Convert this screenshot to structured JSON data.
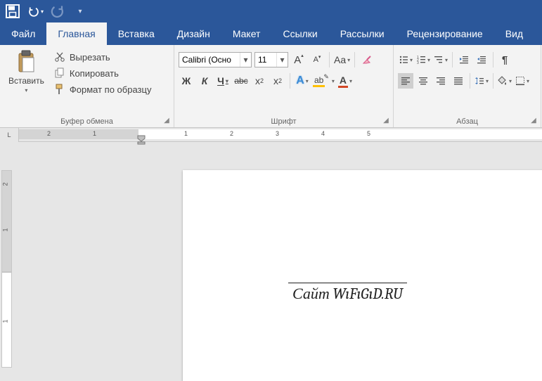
{
  "qat": {
    "save": "save",
    "undo": "undo",
    "redo": "redo"
  },
  "tabs": {
    "file": "Файл",
    "home": "Главная",
    "insert": "Вставка",
    "design": "Дизайн",
    "layout": "Макет",
    "references": "Ссылки",
    "mailings": "Рассылки",
    "review": "Рецензирование",
    "view": "Вид"
  },
  "clipboard": {
    "paste": "Вставить",
    "cut": "Вырезать",
    "copy": "Копировать",
    "format_painter": "Формат по образцу",
    "group": "Буфер обмена"
  },
  "font": {
    "name": "Calibri (Осно",
    "size": "11",
    "bold": "Ж",
    "italic": "К",
    "underline": "Ч",
    "strike": "abc",
    "sub": "x₂",
    "sup": "x²",
    "grow": "A",
    "shrink": "A",
    "case": "Aa",
    "clear": "✎",
    "effects": "A",
    "highlight": "ab",
    "color": "A",
    "group": "Шрифт"
  },
  "paragraph": {
    "group": "Абзац"
  },
  "ruler": {
    "h": [
      "2",
      "1",
      "1",
      "2",
      "3",
      "4",
      "5"
    ],
    "v": [
      "2",
      "1",
      "1"
    ],
    "corner": "L"
  },
  "document": {
    "text": "Сайт WıFıGıD.RU"
  }
}
